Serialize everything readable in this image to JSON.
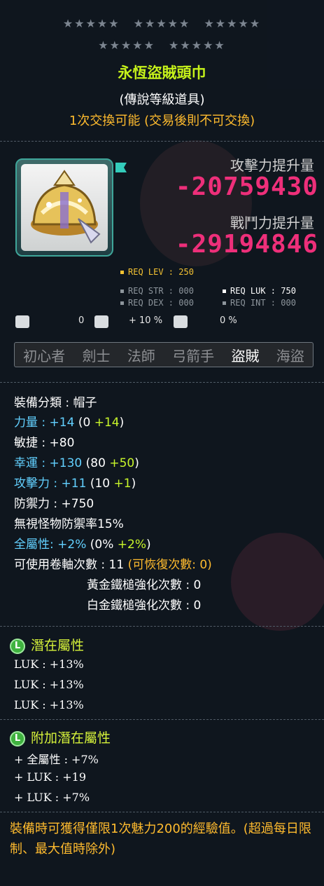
{
  "star_rows": [
    [
      "★★★★★",
      "★★★★★",
      "★★★★★"
    ],
    [
      "★★★★★",
      "★★★★★"
    ]
  ],
  "item": {
    "name": "永恆盜賊頭巾",
    "grade": "(傳說等級道具)",
    "trade": "1次交換可能 (交易後則不可交換)"
  },
  "power": {
    "attack_label": "攻擊力提升量",
    "attack_value": "-20759430",
    "combat_label": "戰鬥力提升量",
    "combat_value": "-29194846"
  },
  "requirements": {
    "lev": "REQ LEV : 250",
    "str": "REQ STR : 000",
    "luk": "REQ LUK : 750",
    "dex": "REQ DEX : 000",
    "int": "REQ INT : 000"
  },
  "mini_stats": {
    "first_value": "0",
    "second_value": "+ 10 %",
    "third_value": "0 %"
  },
  "jobs": [
    "初心者",
    "劍士",
    "法師",
    "弓箭手",
    "盜賊",
    "海盜"
  ],
  "active_job_index": 4,
  "stats": {
    "category": "裝備分類 : 帽子",
    "str_label": "力量 : ",
    "str_value": "+14",
    "str_base": "(0 ",
    "str_bonus": "+14",
    "str_close": ")",
    "dex": "敏捷 : +80",
    "luk_label": "幸運 : ",
    "luk_value": "+130",
    "luk_base": "(80 ",
    "luk_bonus": "+50",
    "luk_close": ")",
    "att_label": "攻擊力 : ",
    "att_value": "+11",
    "att_base": "(10 ",
    "att_bonus": "+1",
    "att_close": ")",
    "def": "防禦力 : +750",
    "ignore_def": "無視怪物防禦率15%",
    "all_label": "全屬性: ",
    "all_value": "+2%",
    "all_base": "(0% ",
    "all_bonus": "+2%",
    "all_close": ")",
    "scroll": "可使用卷軸次數 : 11",
    "scroll_recover": "(可恢復次數: 0)",
    "gold_hammer": "黃金鐵槌強化次數 : 0",
    "plat_hammer": "白金鐵槌強化次數 : 0"
  },
  "potential": {
    "badge": "L",
    "title": "潛在屬性",
    "lines": [
      "LUK : +13%",
      "LUK : +13%",
      "LUK : +13%"
    ]
  },
  "additional": {
    "badge": "L",
    "title": "附加潛在屬性",
    "lines": [
      "+ 全屬性 : +7%",
      "+ LUK : +19",
      "+ LUK : +7%"
    ]
  },
  "footer": "裝備時可獲得僅限1次魅力200的經驗值。(超過每日限制、最大值時除外)",
  "colors": {
    "title": "#c6f21a",
    "trade": "#ffbb2e",
    "power_value": "#ee2f7a",
    "stat_highlight": "#62d0ff",
    "bonus": "#c8f52a",
    "potential_badge": "#3fb23f"
  },
  "icons": [
    "hat-item-icon",
    "star-upgrade-icon",
    "crown-icon",
    "shield-icon",
    "potential-badge-icon"
  ]
}
